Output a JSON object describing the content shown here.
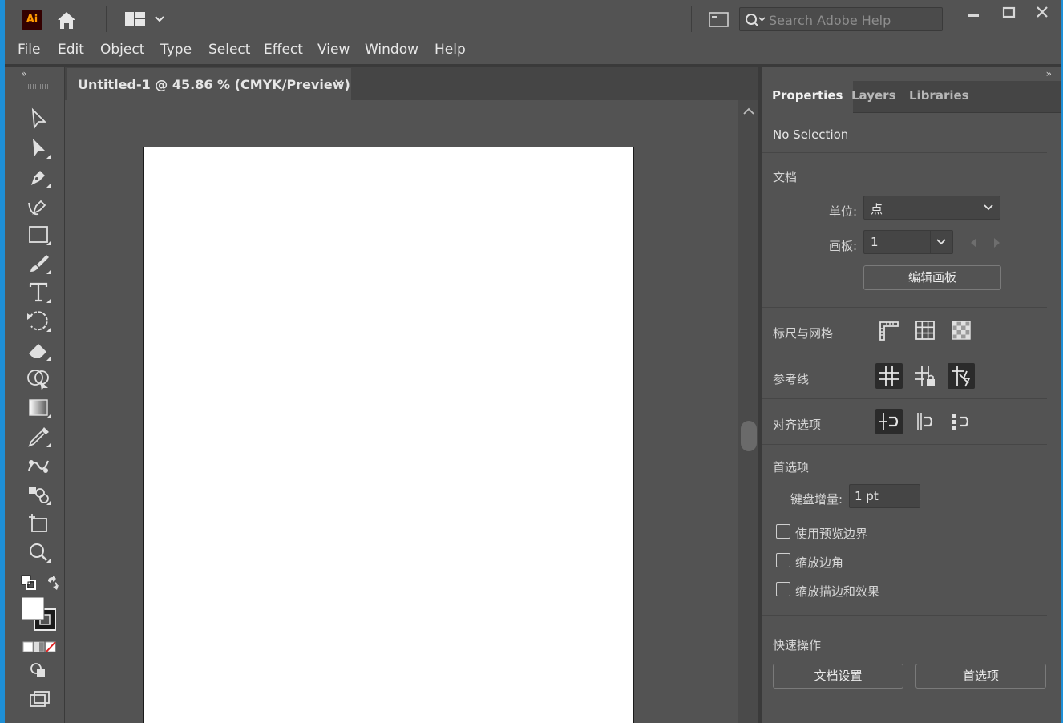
{
  "app": {
    "logo_text": "Ai"
  },
  "search": {
    "placeholder": "Search Adobe Help"
  },
  "menu": [
    "File",
    "Edit",
    "Object",
    "Type",
    "Select",
    "Effect",
    "View",
    "Window",
    "Help"
  ],
  "document": {
    "tab_title": "Untitled-1 @ 45.86 % (CMYK/Preview)",
    "close_glyph": "✕"
  },
  "panel": {
    "tabs": [
      "Properties",
      "Layers",
      "Libraries"
    ],
    "active_tab": "Properties",
    "selection": "No Selection",
    "doc_section": {
      "title": "文档",
      "units_label": "单位:",
      "units_value": "点",
      "artboard_label": "画板:",
      "artboard_value": "1",
      "edit_artboards_label": "编辑画板"
    },
    "rulers_grids": {
      "title": "标尺与网格"
    },
    "guides": {
      "title": "参考线"
    },
    "snap_options": {
      "title": "对齐选项"
    },
    "preferences": {
      "title": "首选项",
      "keyboard_increment_label": "键盘增量:",
      "keyboard_increment_value": "1 pt",
      "checkboxes": [
        "使用预览边界",
        "缩放边角",
        "缩放描边和效果"
      ]
    },
    "quick_actions": {
      "title": "快速操作",
      "doc_setup_label": "文档设置",
      "preferences_label": "首选项"
    }
  }
}
